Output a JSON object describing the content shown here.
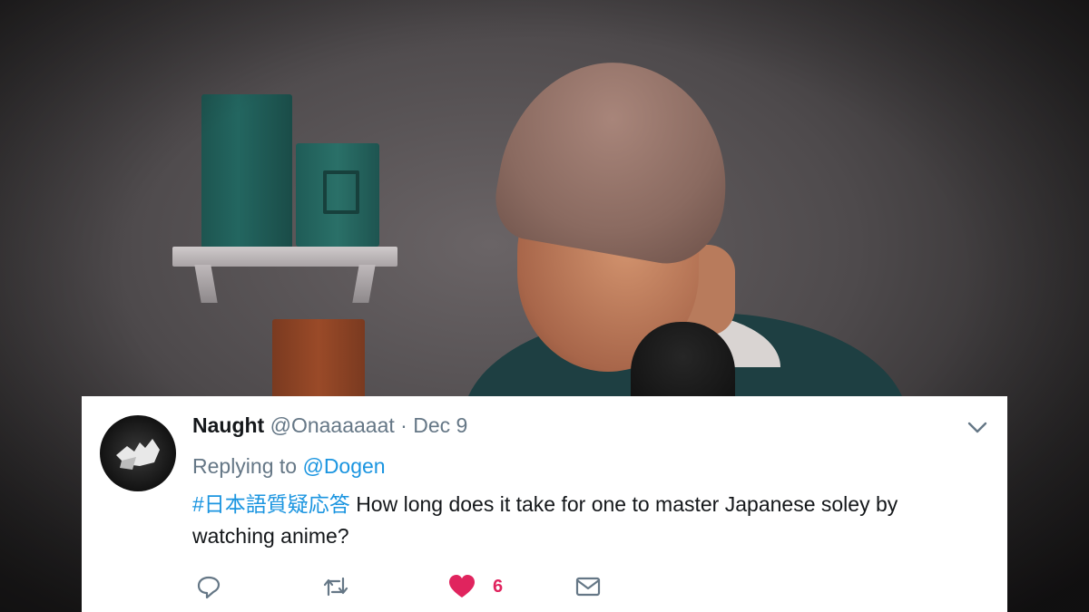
{
  "tweet": {
    "name": "Naught",
    "handle": "@Onaaaaaat",
    "separator": "·",
    "date": "Dec 9",
    "replying_prefix": "Replying to",
    "replying_to": "@Dogen",
    "hashtag": "#日本語質疑応答",
    "text": "How long does it take for one to master Japanese soley by watching anime?",
    "like_count": "6"
  },
  "icons": {
    "menu": "chevron-down-icon",
    "reply": "reply-icon",
    "retweet": "retweet-icon",
    "like": "heart-icon",
    "dm": "envelope-icon"
  },
  "colors": {
    "link": "#1b95e0",
    "like": "#e0245e",
    "muted": "#657786",
    "text": "#14171a"
  }
}
